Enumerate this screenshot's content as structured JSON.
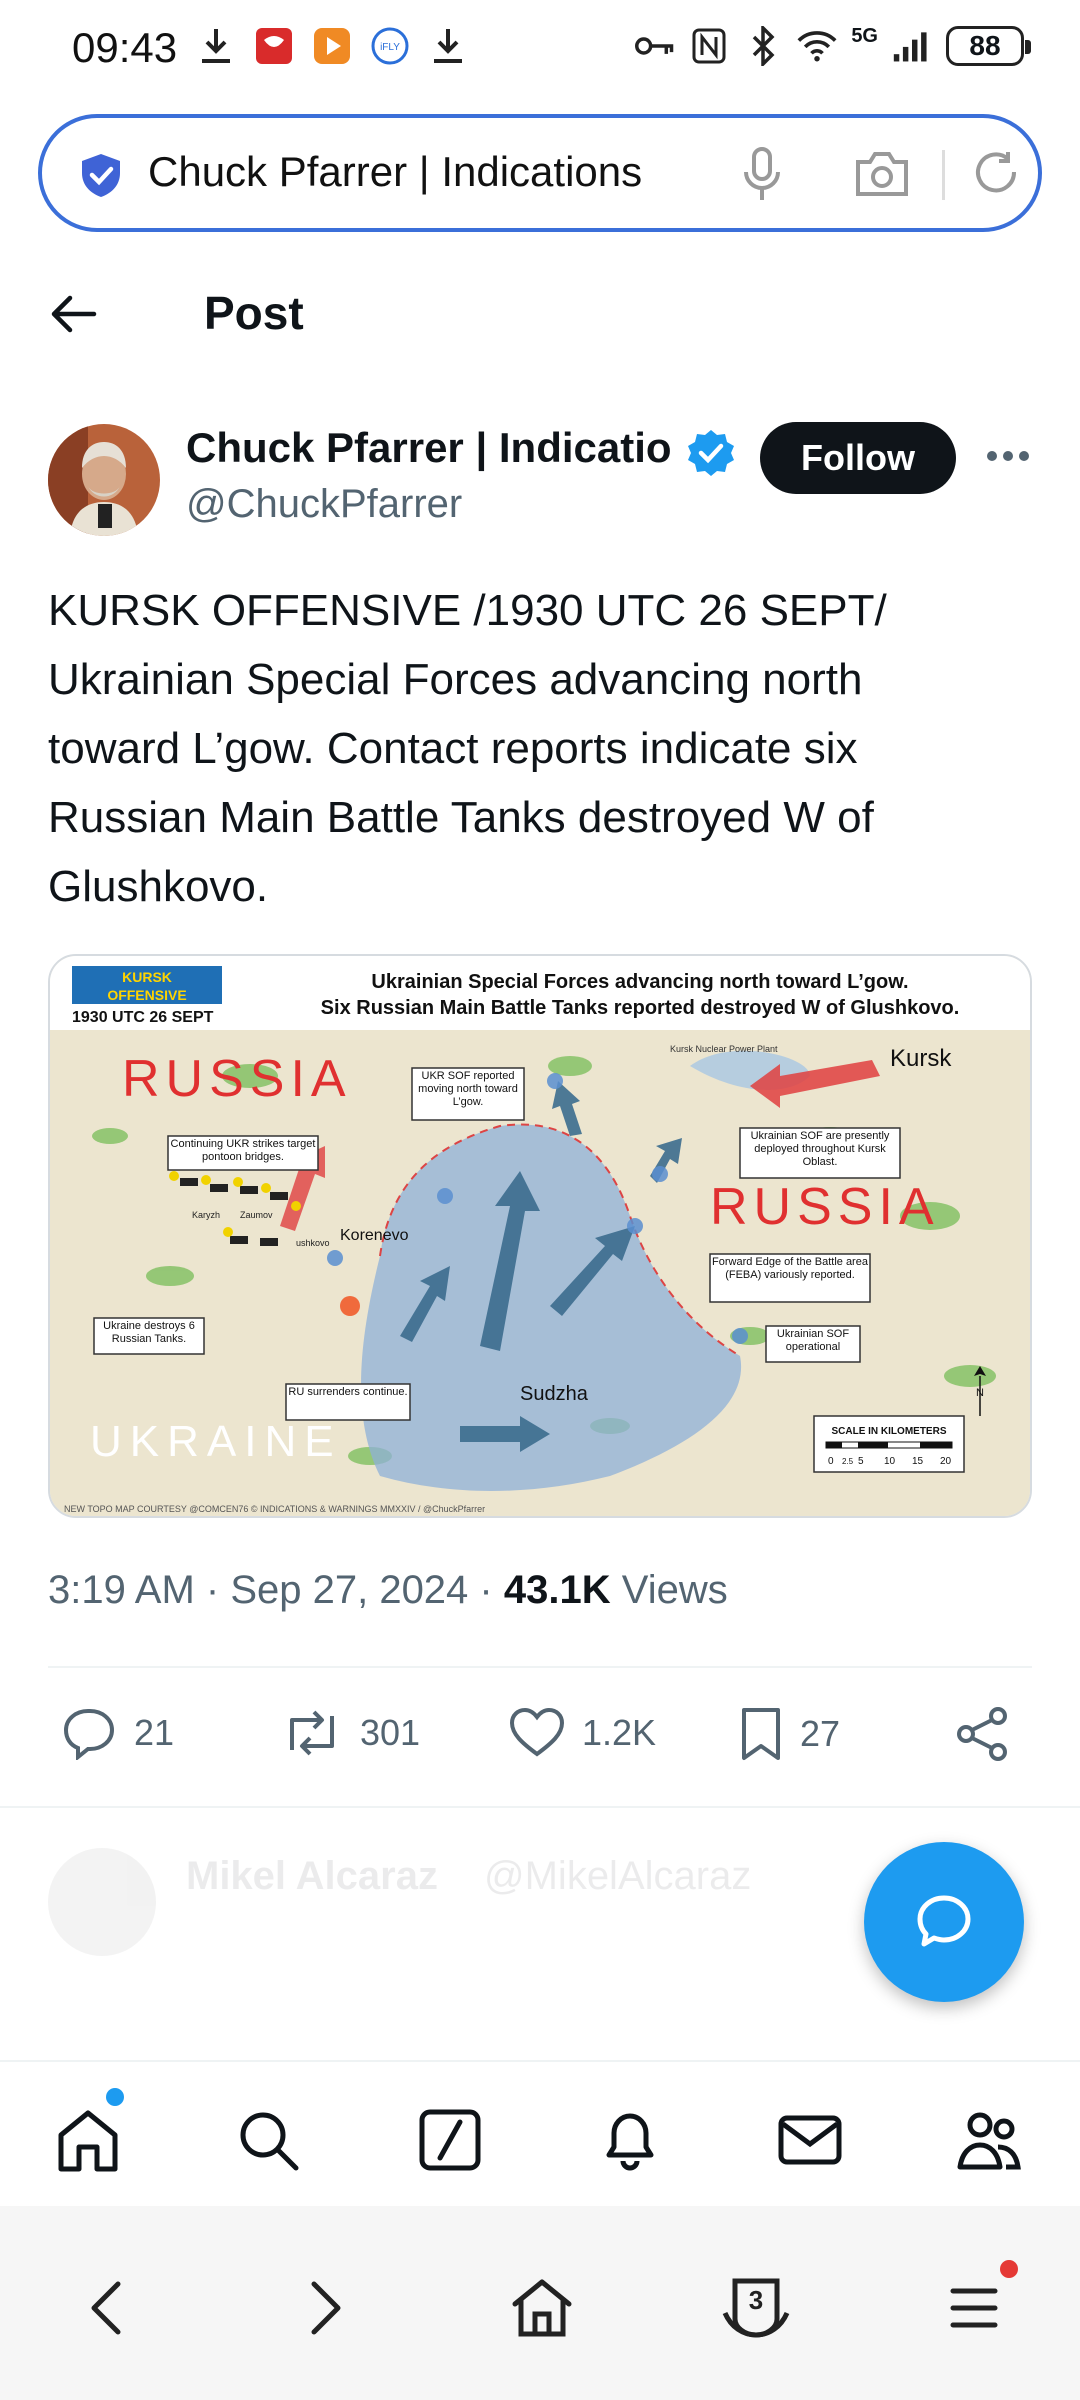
{
  "status_bar": {
    "time": "09:43",
    "network": "5G",
    "battery": "88",
    "icons": [
      "download-icon",
      "shop-icon",
      "video-icon",
      "ifly-icon",
      "download-icon",
      "key-icon",
      "nfc-icon",
      "bluetooth-icon",
      "wifi-icon",
      "signal-icon"
    ]
  },
  "address_bar": {
    "text": "Chuck Pfarrer | Indications",
    "icons": [
      "shield-check-icon",
      "mic-icon",
      "camera-icon",
      "refresh-icon"
    ]
  },
  "header": {
    "title": "Post"
  },
  "post": {
    "author_name": "Chuck Pfarrer | Indicatio",
    "handle": "@ChuckPfarrer",
    "follow_label": "Follow",
    "text": "KURSK OFFENSIVE /1930 UTC 26 SEPT/\nUkrainian Special Forces advancing north\ntoward L’gow. Contact reports indicate six\nRussian Main Battle Tanks  destroyed W of\nGlushkovo.",
    "media": {
      "badge_line1": "KURSK",
      "badge_line2": "OFFENSIVE",
      "badge_time": "1930 UTC 26 SEPT",
      "headline1": "Ukrainian Special Forces advancing north toward L’gow.",
      "headline2": "Six Russian Main Battle Tanks reported destroyed W of Glushkovo.",
      "russia_label": "RUSSIA",
      "ukraine_label": "UKRAINE",
      "kursk": "Kursk",
      "kursk_npp": "Kursk Nuclear Power Plant",
      "korenevo": "Korenevo",
      "sudzha": "Sudzha",
      "karyzh": "Karyzh",
      "zaumov": "Zaumov",
      "glushkovo": "ushkovo",
      "callout_sof_north": "UKR SOF reported moving north toward L’gow.",
      "callout_strikes": "Continuing UKR strikes target pontoon bridges.",
      "callout_deployed": "Ukrainian SOF are presently deployed throughout Kursk Oblast.",
      "callout_feba": "Forward Edge of the Battle area (FEBA) variously reported.",
      "callout_tanks": "Ukraine destroys 6 Russian Tanks.",
      "callout_surrender": "RU surrenders continue.",
      "callout_sof_op": "Ukrainian SOF operational",
      "scale_title": "SCALE IN KILOMETERS",
      "scale_ticks": [
        "0",
        "2.5",
        "5",
        "10",
        "15",
        "20"
      ],
      "north": "N",
      "credit": "NEW TOPO MAP COURTESY @COMCEN76 © INDICATIONS & WARNINGS MMXXIV / @ChuckPfarrer"
    },
    "time": "3:19 AM",
    "date": "Sep 27, 2024",
    "views_count": "43.1K",
    "views_label": "Views",
    "replies": "21",
    "reposts": "301",
    "likes": "1.2K",
    "bookmarks": "27"
  },
  "reply_preview": {
    "name": "Mikel Alcaraz",
    "handle": "@MikelAlcaraz"
  },
  "bottom_nav": [
    "home-icon",
    "search-icon",
    "grok-icon",
    "notifications-icon",
    "messages-icon",
    "communities-icon"
  ],
  "browser_bar": {
    "tab_count": "3",
    "icons": [
      "back-icon",
      "forward-icon",
      "home-icon",
      "tabs-icon",
      "menu-icon"
    ]
  },
  "colors": {
    "accent": "#1d9bf0",
    "address_border": "#3b6fd9",
    "text_primary": "#0f1419",
    "text_secondary": "#536471"
  }
}
